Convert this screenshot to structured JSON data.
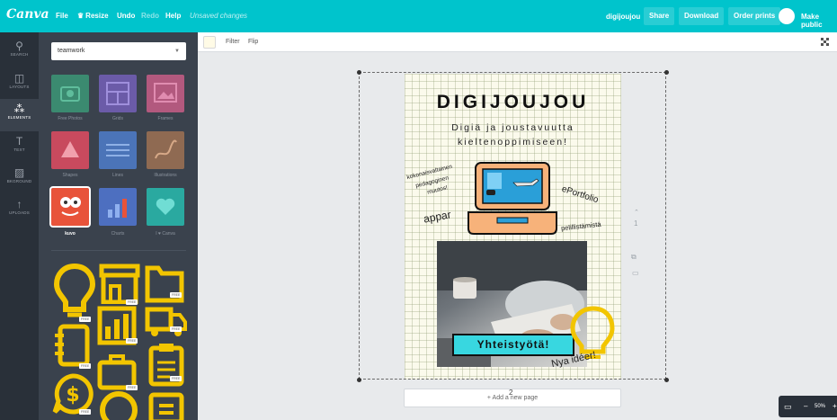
{
  "app": {
    "logo": "Canva"
  },
  "menu": {
    "file": "File",
    "resize": "Resize",
    "undo": "Undo",
    "redo": "Redo",
    "help": "Help",
    "status": "Unsaved changes"
  },
  "header": {
    "design_title": "digijoujou",
    "share": "Share",
    "download": "Download",
    "order_prints": "Order prints",
    "make_public": "Make public"
  },
  "sidebar": {
    "items": [
      {
        "icon": "search-icon",
        "label": "SEARCH"
      },
      {
        "icon": "layouts-icon",
        "label": "LAYOUTS"
      },
      {
        "icon": "elements-icon",
        "label": "ELEMENTS"
      },
      {
        "icon": "text-icon",
        "label": "TEXT"
      },
      {
        "icon": "background-icon",
        "label": "BKGROUND"
      },
      {
        "icon": "upload-icon",
        "label": "UPLOADS"
      }
    ]
  },
  "panel": {
    "search_value": "teamwork",
    "categories": [
      {
        "label": "Free Photos",
        "color": "#3b8a70"
      },
      {
        "label": "Grids",
        "color": "#6b5ba8"
      },
      {
        "label": "Frames",
        "color": "#b2597e"
      },
      {
        "label": "Shapes",
        "color": "#c84a5e"
      },
      {
        "label": "Lines",
        "color": "#4b74b8"
      },
      {
        "label": "Illustrations",
        "color": "#8f6a52"
      },
      {
        "label": "kuvo",
        "color": "#e8533a"
      },
      {
        "label": "Charts",
        "color": "#4d6fc0"
      },
      {
        "label": "I ♥ Canva",
        "color": "#2aa9a0"
      }
    ],
    "free_badge": "FREE",
    "icon_color": "#f2c500"
  },
  "toolbar": {
    "filter": "Filter",
    "flip": "Flip"
  },
  "poster": {
    "title": "DIGIJOUJOU",
    "subtitle_line1": "Digiä ja joustavuutta",
    "subtitle_line2": "kieltenoppimiseen!",
    "word_1": "kokonaisvaltainen",
    "word_2": "pedagoginen",
    "word_3": "muutos!",
    "word_eportfolio": "ePortfolio",
    "word_appar": "appar",
    "word_pelillistamista": "pelillistämistä",
    "banner": "Yhteistyötä!",
    "ideas": "Nya idéer!"
  },
  "canvas": {
    "add_page": "+ Add a new page",
    "page_number": "1",
    "page_count": "2"
  },
  "zoom": {
    "value": "50%",
    "minus": "–",
    "plus": "+"
  }
}
